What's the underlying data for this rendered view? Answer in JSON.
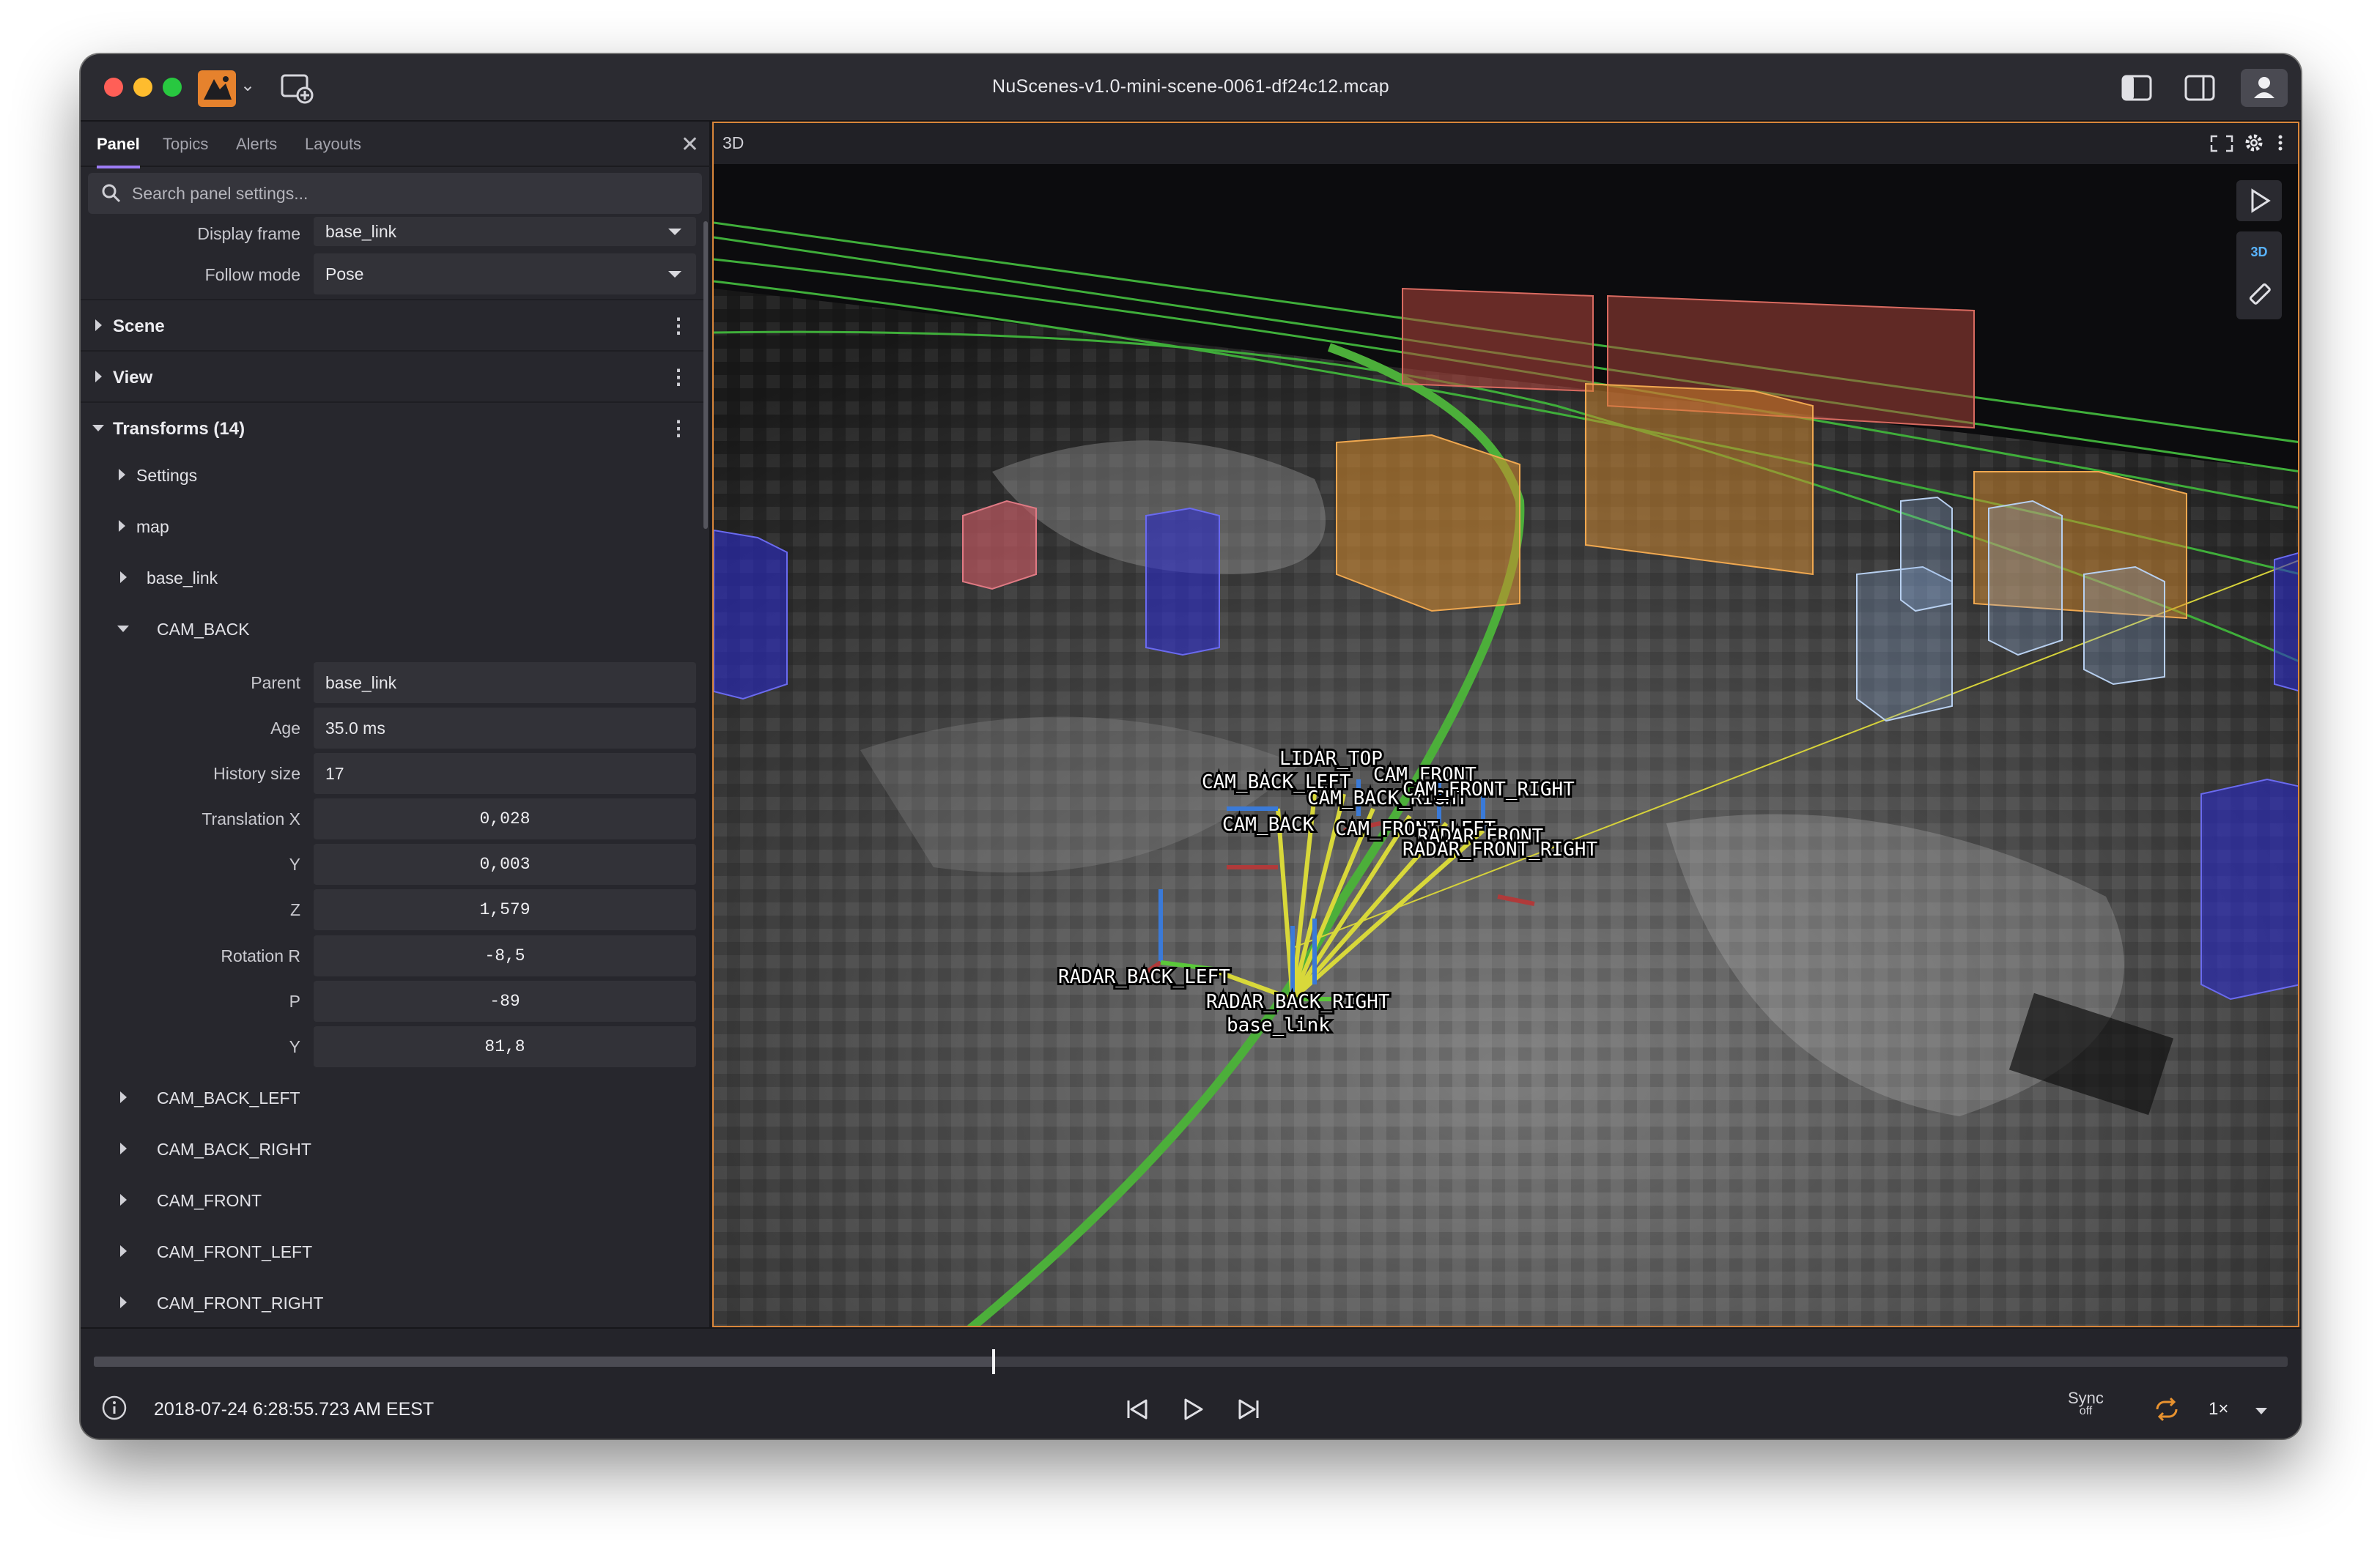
{
  "window": {
    "title": "NuScenes-v1.0-mini-scene-0061-df24c12.mcap"
  },
  "sidebar": {
    "tabs": [
      {
        "label": "Panel",
        "active": true
      },
      {
        "label": "Topics",
        "active": false
      },
      {
        "label": "Alerts",
        "active": false
      },
      {
        "label": "Layouts",
        "active": false
      }
    ],
    "search_placeholder": "Search panel settings...",
    "display_frame": {
      "label": "Display frame",
      "value": "base_link"
    },
    "follow_mode": {
      "label": "Follow mode",
      "value": "Pose"
    },
    "sections": {
      "scene": "Scene",
      "view": "View",
      "transforms": "Transforms (14)"
    },
    "transform_nodes": {
      "settings": "Settings",
      "map": "map",
      "base_link": "base_link",
      "cam_back": "CAM_BACK"
    },
    "cam_back_fields": {
      "parent": {
        "label": "Parent",
        "value": "base_link"
      },
      "age": {
        "label": "Age",
        "value": "35.0 ms"
      },
      "history": {
        "label": "History size",
        "value": "17"
      },
      "tx": {
        "label": "Translation X",
        "value": "0,028"
      },
      "ty": {
        "label": "Y",
        "value": "0,003"
      },
      "tz": {
        "label": "Z",
        "value": "1,579"
      },
      "rr": {
        "label": "Rotation R",
        "value": "-8,5"
      },
      "rp": {
        "label": "P",
        "value": "-89"
      },
      "ry": {
        "label": "Y",
        "value": "81,8"
      }
    },
    "more_frames": [
      "CAM_BACK_LEFT",
      "CAM_BACK_RIGHT",
      "CAM_FRONT",
      "CAM_FRONT_LEFT",
      "CAM_FRONT_RIGHT"
    ]
  },
  "viewport": {
    "title": "3D",
    "mode": "3D",
    "frame_labels": [
      "LIDAR_TOP",
      "CAM_BACK_LEFT",
      "CAM_FRONT",
      "CAM_BACK_RIGHT",
      "CAM_FRONT_RIGHT",
      "CAM_BACK",
      "CAM_FRONT_LEFT",
      "RADAR_FRONT",
      "RADAR_FRONT_RIGHT",
      "RADAR_BACK_LEFT",
      "RADAR_BACK_RIGHT",
      "base_link"
    ],
    "colors": {
      "accent_border": "#d9863a",
      "path_green": "#4caf3a",
      "box_red": "#b4463c",
      "box_orange": "#d68a2c",
      "box_blue": "#2c2cc8",
      "box_lightblue": "#8fb4e6"
    }
  },
  "playback": {
    "timestamp": "2018-07-24 6:28:55.723 AM EEST",
    "progress": 0.41,
    "sync_label": "Sync",
    "sync_state": "off",
    "speed": "1×"
  },
  "icons": [
    "app-logo-icon",
    "new-window-icon",
    "left-sidebar-icon",
    "right-sidebar-icon",
    "user-icon",
    "search-icon",
    "close-icon",
    "fullscreen-icon",
    "gear-icon",
    "more-icon",
    "select-pointer-icon",
    "ruler-icon",
    "info-icon",
    "skip-back-icon",
    "play-icon",
    "skip-forward-icon",
    "loop-icon"
  ]
}
